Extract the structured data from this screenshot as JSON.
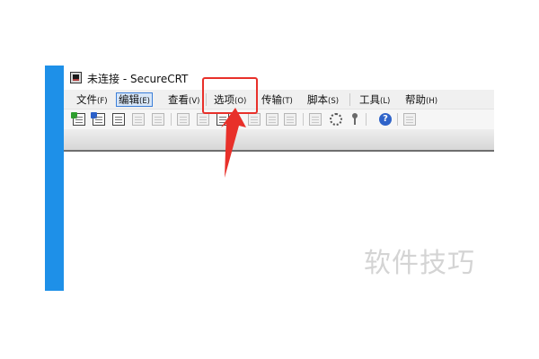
{
  "window": {
    "title": "未连接 - SecureCRT"
  },
  "menubar": {
    "items": [
      {
        "label": "文件",
        "mnemonic": "(F)"
      },
      {
        "label": "编辑",
        "mnemonic": "(E)"
      },
      {
        "label": "查看",
        "mnemonic": "(V)"
      },
      {
        "label": "选项",
        "mnemonic": "(O)"
      },
      {
        "label": "传输",
        "mnemonic": "(T)"
      },
      {
        "label": "脚本",
        "mnemonic": "(S)"
      },
      {
        "label": "工具",
        "mnemonic": "(L)"
      },
      {
        "label": "帮助",
        "mnemonic": "(H)"
      }
    ],
    "active_item": "编辑",
    "highlighted_item": "选项"
  },
  "toolbar": {
    "icons": [
      "connect-icon",
      "quick-connect-icon",
      "connect-in-tab-icon",
      "reconnect-icon",
      "disconnect-icon",
      "copy-icon",
      "paste-icon",
      "find-icon",
      "print-icon",
      "print-selection-icon",
      "print-icon-2",
      "session-options-icon",
      "global-options-icon",
      "key-icon",
      "help-icon",
      "sftp-icon"
    ]
  },
  "annotation": {
    "highlight_color": "#e8302a"
  },
  "watermark": {
    "text": "软件技巧"
  },
  "colors": {
    "window_border": "#1e90e8",
    "active_menu_border": "#3c7fd9",
    "active_menu_bg": "#d7e6f8"
  }
}
